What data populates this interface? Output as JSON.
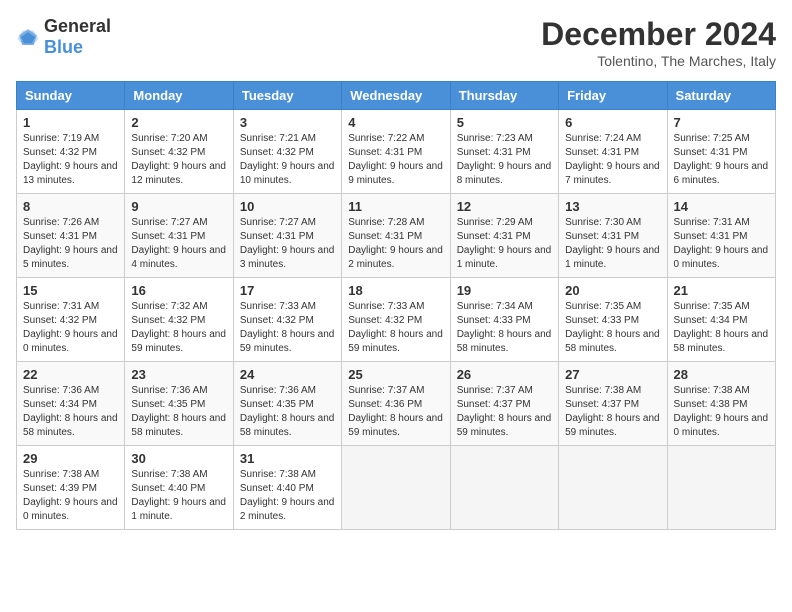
{
  "logo": {
    "general": "General",
    "blue": "Blue"
  },
  "header": {
    "month": "December 2024",
    "location": "Tolentino, The Marches, Italy"
  },
  "weekdays": [
    "Sunday",
    "Monday",
    "Tuesday",
    "Wednesday",
    "Thursday",
    "Friday",
    "Saturday"
  ],
  "weeks": [
    [
      {
        "day": "1",
        "sunrise": "7:19 AM",
        "sunset": "4:32 PM",
        "daylight": "9 hours and 13 minutes."
      },
      {
        "day": "2",
        "sunrise": "7:20 AM",
        "sunset": "4:32 PM",
        "daylight": "9 hours and 12 minutes."
      },
      {
        "day": "3",
        "sunrise": "7:21 AM",
        "sunset": "4:32 PM",
        "daylight": "9 hours and 10 minutes."
      },
      {
        "day": "4",
        "sunrise": "7:22 AM",
        "sunset": "4:31 PM",
        "daylight": "9 hours and 9 minutes."
      },
      {
        "day": "5",
        "sunrise": "7:23 AM",
        "sunset": "4:31 PM",
        "daylight": "9 hours and 8 minutes."
      },
      {
        "day": "6",
        "sunrise": "7:24 AM",
        "sunset": "4:31 PM",
        "daylight": "9 hours and 7 minutes."
      },
      {
        "day": "7",
        "sunrise": "7:25 AM",
        "sunset": "4:31 PM",
        "daylight": "9 hours and 6 minutes."
      }
    ],
    [
      {
        "day": "8",
        "sunrise": "7:26 AM",
        "sunset": "4:31 PM",
        "daylight": "9 hours and 5 minutes."
      },
      {
        "day": "9",
        "sunrise": "7:27 AM",
        "sunset": "4:31 PM",
        "daylight": "9 hours and 4 minutes."
      },
      {
        "day": "10",
        "sunrise": "7:27 AM",
        "sunset": "4:31 PM",
        "daylight": "9 hours and 3 minutes."
      },
      {
        "day": "11",
        "sunrise": "7:28 AM",
        "sunset": "4:31 PM",
        "daylight": "9 hours and 2 minutes."
      },
      {
        "day": "12",
        "sunrise": "7:29 AM",
        "sunset": "4:31 PM",
        "daylight": "9 hours and 1 minute."
      },
      {
        "day": "13",
        "sunrise": "7:30 AM",
        "sunset": "4:31 PM",
        "daylight": "9 hours and 1 minute."
      },
      {
        "day": "14",
        "sunrise": "7:31 AM",
        "sunset": "4:31 PM",
        "daylight": "9 hours and 0 minutes."
      }
    ],
    [
      {
        "day": "15",
        "sunrise": "7:31 AM",
        "sunset": "4:32 PM",
        "daylight": "9 hours and 0 minutes."
      },
      {
        "day": "16",
        "sunrise": "7:32 AM",
        "sunset": "4:32 PM",
        "daylight": "8 hours and 59 minutes."
      },
      {
        "day": "17",
        "sunrise": "7:33 AM",
        "sunset": "4:32 PM",
        "daylight": "8 hours and 59 minutes."
      },
      {
        "day": "18",
        "sunrise": "7:33 AM",
        "sunset": "4:32 PM",
        "daylight": "8 hours and 59 minutes."
      },
      {
        "day": "19",
        "sunrise": "7:34 AM",
        "sunset": "4:33 PM",
        "daylight": "8 hours and 58 minutes."
      },
      {
        "day": "20",
        "sunrise": "7:35 AM",
        "sunset": "4:33 PM",
        "daylight": "8 hours and 58 minutes."
      },
      {
        "day": "21",
        "sunrise": "7:35 AM",
        "sunset": "4:34 PM",
        "daylight": "8 hours and 58 minutes."
      }
    ],
    [
      {
        "day": "22",
        "sunrise": "7:36 AM",
        "sunset": "4:34 PM",
        "daylight": "8 hours and 58 minutes."
      },
      {
        "day": "23",
        "sunrise": "7:36 AM",
        "sunset": "4:35 PM",
        "daylight": "8 hours and 58 minutes."
      },
      {
        "day": "24",
        "sunrise": "7:36 AM",
        "sunset": "4:35 PM",
        "daylight": "8 hours and 58 minutes."
      },
      {
        "day": "25",
        "sunrise": "7:37 AM",
        "sunset": "4:36 PM",
        "daylight": "8 hours and 59 minutes."
      },
      {
        "day": "26",
        "sunrise": "7:37 AM",
        "sunset": "4:37 PM",
        "daylight": "8 hours and 59 minutes."
      },
      {
        "day": "27",
        "sunrise": "7:38 AM",
        "sunset": "4:37 PM",
        "daylight": "8 hours and 59 minutes."
      },
      {
        "day": "28",
        "sunrise": "7:38 AM",
        "sunset": "4:38 PM",
        "daylight": "9 hours and 0 minutes."
      }
    ],
    [
      {
        "day": "29",
        "sunrise": "7:38 AM",
        "sunset": "4:39 PM",
        "daylight": "9 hours and 0 minutes."
      },
      {
        "day": "30",
        "sunrise": "7:38 AM",
        "sunset": "4:40 PM",
        "daylight": "9 hours and 1 minute."
      },
      {
        "day": "31",
        "sunrise": "7:38 AM",
        "sunset": "4:40 PM",
        "daylight": "9 hours and 2 minutes."
      },
      null,
      null,
      null,
      null
    ]
  ],
  "labels": {
    "sunrise_prefix": "Sunrise: ",
    "sunset_prefix": "Sunset: ",
    "daylight_prefix": "Daylight: "
  }
}
